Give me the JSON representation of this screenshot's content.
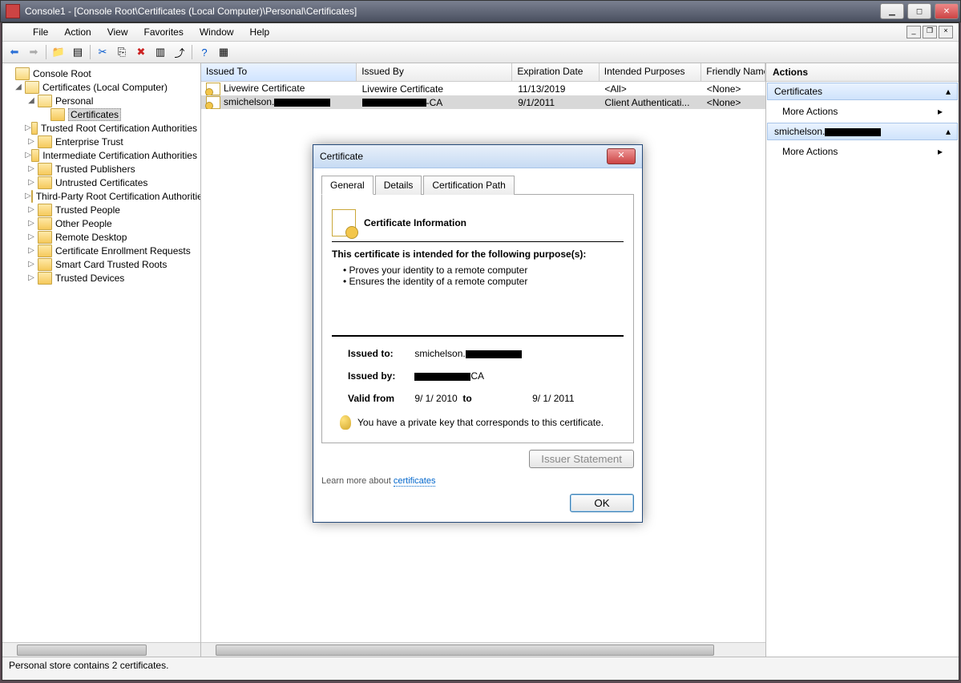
{
  "window": {
    "title": "Console1 - [Console Root\\Certificates (Local Computer)\\Personal\\Certificates]"
  },
  "menu": {
    "file": "File",
    "action": "Action",
    "view": "View",
    "favorites": "Favorites",
    "window": "Window",
    "help": "Help"
  },
  "tree": {
    "root": "Console Root",
    "certs": "Certificates (Local Computer)",
    "items": [
      "Personal",
      "Certificates",
      "Trusted Root Certification Authorities",
      "Enterprise Trust",
      "Intermediate Certification Authorities",
      "Trusted Publishers",
      "Untrusted Certificates",
      "Third-Party Root Certification Authorities",
      "Trusted People",
      "Other People",
      "Remote Desktop",
      "Certificate Enrollment Requests",
      "Smart Card Trusted Roots",
      "Trusted Devices"
    ]
  },
  "columns": {
    "c0": "Issued To",
    "c1": "Issued By",
    "c2": "Expiration Date",
    "c3": "Intended Purposes",
    "c4": "Friendly Name"
  },
  "rows": [
    {
      "to": "Livewire Certificate",
      "by": "Livewire Certificate",
      "exp": "11/13/2019",
      "purp": "<All>",
      "fn": "<None>"
    },
    {
      "to": "smichelson.",
      "to_redacted": true,
      "by_suffix": "-CA",
      "by_redacted": true,
      "exp": "9/1/2011",
      "purp": "Client Authenticati...",
      "fn": "<None>"
    }
  ],
  "actions": {
    "header": "Actions",
    "sec1": "Certificates",
    "more": "More Actions",
    "sec2": "smichelson.",
    "sec2_redacted": true
  },
  "status": "Personal store contains 2 certificates.",
  "dialog": {
    "title": "Certificate",
    "tabs": {
      "general": "General",
      "details": "Details",
      "path": "Certification Path"
    },
    "heading": "Certificate Information",
    "purposes_label": "This certificate is intended for the following purpose(s):",
    "purposes": [
      "Proves your identity to a remote computer",
      "Ensures the identity of a remote computer"
    ],
    "issued_to_label": "Issued to:",
    "issued_to": "smichelson.",
    "issued_to_redacted": true,
    "issued_by_label": "Issued by:",
    "issued_by_suffix": "CA",
    "issued_by_redacted": true,
    "valid_label": "Valid from",
    "valid_from": "9/ 1/ 2010",
    "valid_to_label": "to",
    "valid_to": "9/ 1/ 2011",
    "keynote": "You have a private key that corresponds to this certificate.",
    "issuer_stmt": "Issuer Statement",
    "learn_prefix": "Learn more about ",
    "learn_link": "certificates",
    "ok": "OK"
  }
}
